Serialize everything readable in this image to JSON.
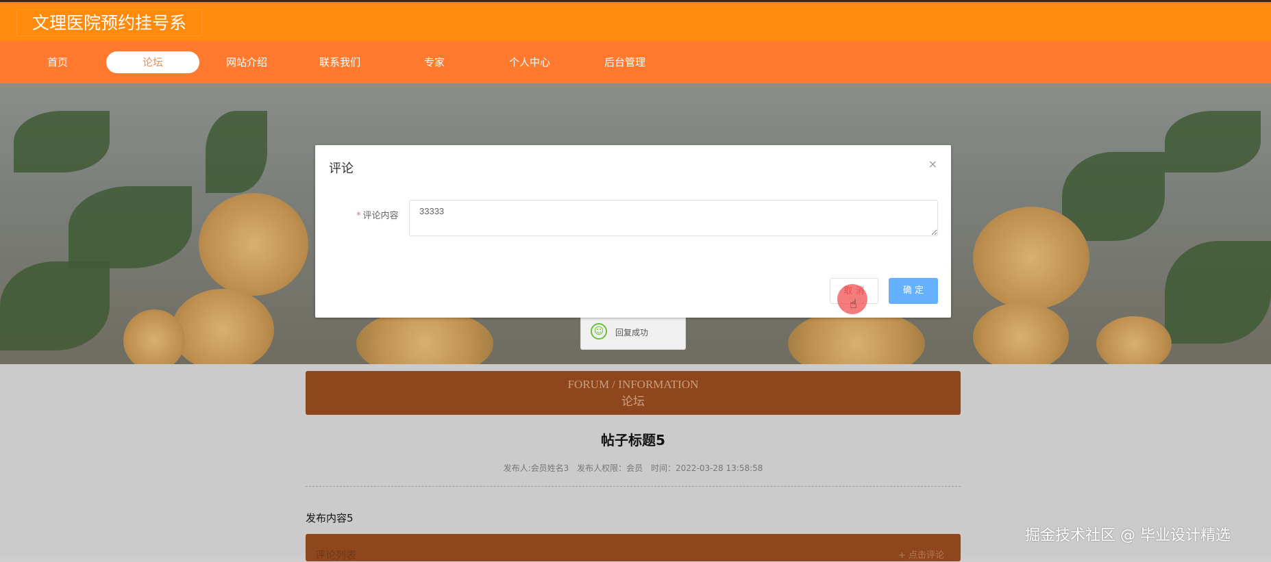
{
  "header": {
    "site_title": "文理医院预约挂号系"
  },
  "nav": {
    "items": [
      {
        "label": "首页",
        "active": false
      },
      {
        "label": "论坛",
        "active": true
      },
      {
        "label": "网站介绍",
        "active": false
      },
      {
        "label": "联系我们",
        "active": false
      },
      {
        "label": "专家",
        "active": false
      },
      {
        "label": "个人中心",
        "active": false
      },
      {
        "label": "后台管理",
        "active": false
      }
    ]
  },
  "forum": {
    "heading_en": "FORUM / INFORMATION",
    "heading_cn": "论坛"
  },
  "post": {
    "title": "帖子标题5",
    "author": "发布人:会员姓名3",
    "role": "发布人权限：会员",
    "time": "时间：2022-03-28 13:58:58",
    "content": "发布内容5"
  },
  "comments": {
    "title": "评论列表",
    "add_label": "+ 点击评论"
  },
  "dialog": {
    "title": "评论",
    "close": "×",
    "field_label": "评论内容",
    "field_value": "33333",
    "cancel_label": "取 消",
    "confirm_label": "确 定"
  },
  "toast": {
    "message": "回复成功"
  },
  "watermark": "掘金技术社区 @ 毕业设计精选"
}
